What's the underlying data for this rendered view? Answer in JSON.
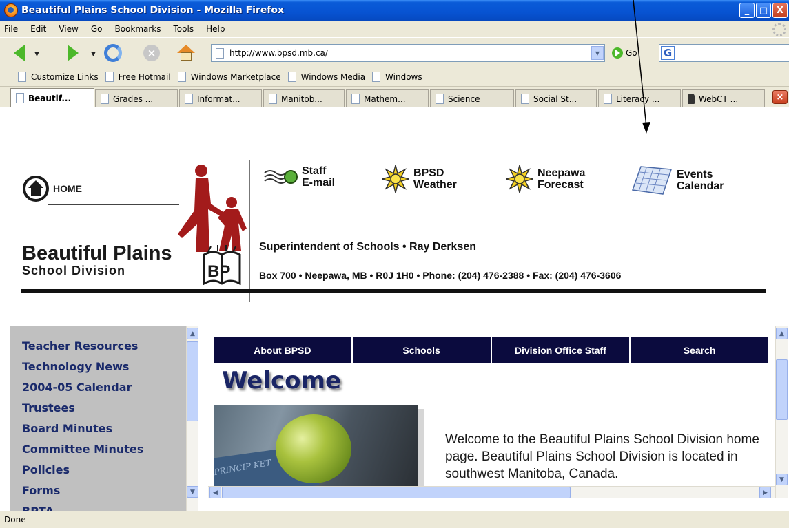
{
  "window": {
    "title": "Beautiful Plains School Division - Mozilla Firefox",
    "minimize": "_",
    "maximize": "□",
    "close": "X"
  },
  "menu": [
    "File",
    "Edit",
    "View",
    "Go",
    "Bookmarks",
    "Tools",
    "Help"
  ],
  "navigation": {
    "url": "http://www.bpsd.mb.ca/",
    "go_label": "Go",
    "google_label": "G"
  },
  "links_toolbar": [
    "Customize Links",
    "Free Hotmail",
    "Windows Marketplace",
    "Windows Media",
    "Windows"
  ],
  "tabs": [
    {
      "label": "Beautif...",
      "active": true
    },
    {
      "label": "Grades ..."
    },
    {
      "label": "Informat..."
    },
    {
      "label": "Manitob..."
    },
    {
      "label": "Mathem..."
    },
    {
      "label": "Science"
    },
    {
      "label": "Social St..."
    },
    {
      "label": "Literacy ..."
    },
    {
      "label": "WebCT ..."
    }
  ],
  "header": {
    "home_label": "HOME",
    "logo_line1": "Beautiful Plains",
    "logo_line2": "School Division",
    "logo_badge": "BP",
    "quick_links": [
      {
        "line1": "Staff",
        "line2": "E-mail",
        "icon": "email-wave-icon"
      },
      {
        "line1": "BPSD",
        "line2": "Weather",
        "icon": "sun-icon"
      },
      {
        "line1": "Neepawa",
        "line2": "Forecast",
        "icon": "sun-icon"
      },
      {
        "line1": "Events",
        "line2": "Calendar",
        "icon": "calendar-icon"
      }
    ],
    "superintendent": "Superintendent of Schools • Ray Derksen",
    "address": "Box 700 • Neepawa, MB • R0J 1H0 • Phone: (204) 476-2388 • Fax: (204) 476-3606"
  },
  "sidebar": {
    "items": [
      "Teacher Resources",
      "Technology News",
      "2004-05 Calendar",
      "Trustees",
      "Board Minutes",
      "Committee Minutes",
      "Policies",
      "Forms",
      "BPTA"
    ]
  },
  "main_nav": [
    "About BPSD",
    "Schools",
    "Division Office Staff",
    "Search"
  ],
  "main": {
    "heading": "Welcome",
    "photo_text": "PRINCIP KET",
    "welcome_text": "Welcome to the Beautiful Plains School Division home page. Beautiful Plains School Division is located in southwest Manitoba, Canada."
  },
  "status": {
    "text": "Done"
  },
  "colors": {
    "titlebar": "#0753d2",
    "nav_strip": "#0b0b3e",
    "sidebar_bg": "#c0c0c0",
    "sidebar_text": "#1a2a6b",
    "figure_red": "#a31b1b"
  }
}
